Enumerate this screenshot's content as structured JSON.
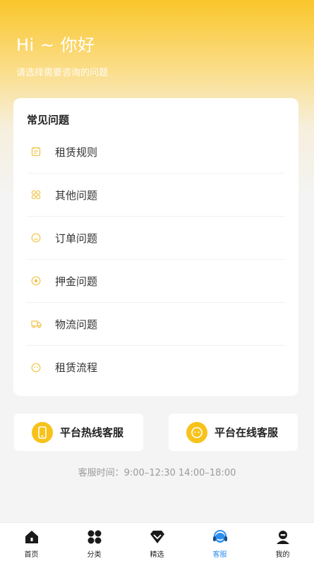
{
  "header": {
    "greeting": "Hi ~ 你好",
    "subtitle": "请选择需要咨询的问题"
  },
  "faq": {
    "title": "常见问题",
    "items": [
      {
        "label": "租赁规则",
        "icon": "document-icon"
      },
      {
        "label": "其他问题",
        "icon": "grid-icon"
      },
      {
        "label": "订单问题",
        "icon": "smile-icon"
      },
      {
        "label": "押金问题",
        "icon": "coin-icon"
      },
      {
        "label": "物流问题",
        "icon": "truck-icon"
      },
      {
        "label": "租赁流程",
        "icon": "face-icon"
      }
    ]
  },
  "service": {
    "hotline_label": "平台热线客服",
    "online_label": "平台在线客服",
    "hours": "客服时间：9:00–12:30 14:00–18:00"
  },
  "tabbar": {
    "items": [
      {
        "label": "首页",
        "icon": "home-icon"
      },
      {
        "label": "分类",
        "icon": "category-icon"
      },
      {
        "label": "精选",
        "icon": "diamond-icon"
      },
      {
        "label": "客服",
        "icon": "headset-icon"
      },
      {
        "label": "我的",
        "icon": "user-icon"
      }
    ],
    "active": "客服"
  },
  "colors": {
    "accent": "#f7c21a",
    "active_tab": "#2e8ef0"
  }
}
